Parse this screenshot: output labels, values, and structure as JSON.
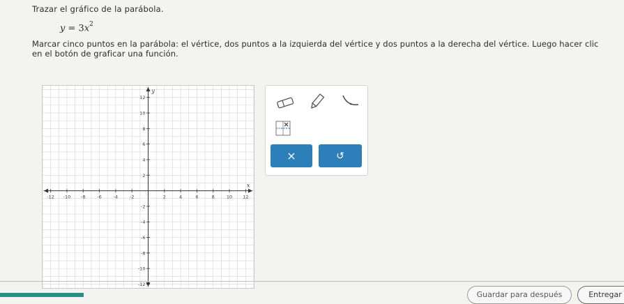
{
  "instruction": "Trazar el gráfico de la parábola.",
  "equation": {
    "lhs": "y",
    "equals": "=",
    "coef": "3",
    "var": "x",
    "exponent": "2"
  },
  "description": "Marcar cinco puntos en la parábola: el vértice, dos puntos a la izquierda del vértice y dos puntos a la derecha del vértice. Luego hacer clic en el botón de graficar una función.",
  "graph": {
    "x_axis_label": "x",
    "y_axis_label": "y",
    "x_ticks": [
      "-12",
      "-10",
      "-8",
      "-6",
      "-4",
      "-2",
      "2",
      "4",
      "6",
      "8",
      "10",
      "12"
    ],
    "y_ticks": [
      "12",
      "10",
      "8",
      "6",
      "4",
      "2",
      "-2",
      "-4",
      "-6",
      "-8",
      "-10",
      "-12"
    ],
    "x_range": [
      -13,
      13
    ],
    "y_range": [
      -12.5,
      13.5
    ],
    "grid": true
  },
  "tools": {
    "eraser": "eraser-icon",
    "pencil": "pencil-icon",
    "graph_function": "parabola-tool-icon",
    "no_solution": "no-solution-icon",
    "delete_label": "×",
    "undo_label": "↺"
  },
  "footer": {
    "save_later_label": "Guardar para después",
    "submit_label": "Entregar"
  },
  "colors": {
    "accent": "#2c7fb8",
    "grid": "#d4d4d4",
    "axis": "#333333"
  }
}
